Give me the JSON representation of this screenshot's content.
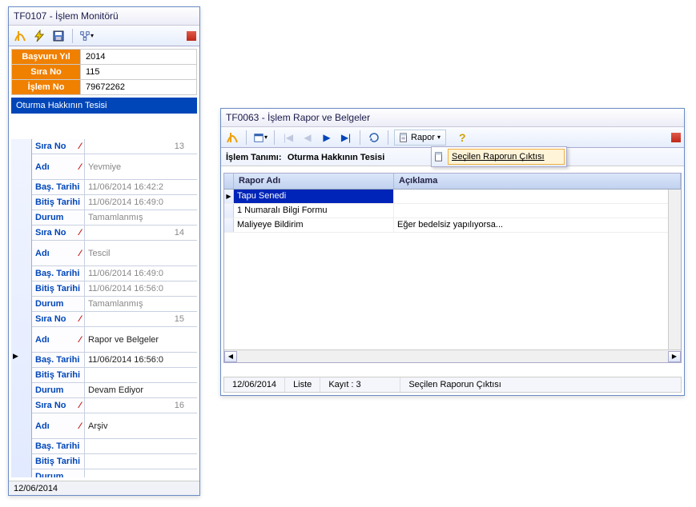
{
  "left": {
    "title": "TF0107 - İşlem Monitörü",
    "fields": {
      "basvuru_yil_label": "Başvuru Yıl",
      "basvuru_yil": "2014",
      "sira_no_label": "Sıra No",
      "sira_no": "115",
      "islem_no_label": "İşlem No",
      "islem_no": "79672262"
    },
    "blue_bar": "Oturma Hakkının Tesisi",
    "grid_labels": {
      "sira_no": "Sıra No",
      "adi": "Adı",
      "bas_tarihi": "Baş. Tarihi",
      "bitis_tarihi": "Bitiş Tarihi",
      "durum": "Durum"
    },
    "rows": [
      {
        "sira": "13",
        "adi": "Yevmiye",
        "bas": "11/06/2014 16:42:2",
        "bit": "11/06/2014 16:49:0",
        "durum": "Tamamlanmış",
        "adi_dim": true,
        "bas_dim": true,
        "bit_dim": true,
        "dur_dim": true
      },
      {
        "sira": "14",
        "adi": "Tescil",
        "bas": "11/06/2014 16:49:0",
        "bit": "11/06/2014 16:56:0",
        "durum": "Tamamlanmış",
        "adi_dim": true,
        "bas_dim": true,
        "bit_dim": true,
        "dur_dim": true
      },
      {
        "sira": "15",
        "adi": "Rapor ve Belgeler",
        "bas": "11/06/2014 16:56:0",
        "bit": "",
        "durum": "Devam Ediyor",
        "adi_black": true,
        "bas_black": true,
        "dur_black": true
      },
      {
        "sira": "16",
        "adi": "Arşiv",
        "bas": "",
        "bit": "",
        "durum": "",
        "adi_black": true
      }
    ],
    "status_date": "12/06/2014"
  },
  "right": {
    "title": "TF0063 - İşlem Rapor ve Belgeler",
    "rapor_button": "Rapor",
    "popup_item": "Seçilen Raporun Çıktısı",
    "desc_label": "İşlem Tanımı:",
    "desc_value": "Oturma Hakkının Tesisi",
    "columns": {
      "name": "Rapor Adı",
      "desc": "Açıklama"
    },
    "rows": [
      {
        "name": "Tapu Senedi",
        "desc": "",
        "selected": true
      },
      {
        "name": "1 Numaralı Bilgi Formu",
        "desc": ""
      },
      {
        "name": "Maliyeye Bildirim",
        "desc": "Eğer bedelsiz yapılıyorsa..."
      }
    ],
    "status": {
      "date": "12/06/2014",
      "liste": "Liste",
      "kayit": "Kayıt : 3",
      "action": "Seçilen Raporun Çıktısı"
    }
  }
}
